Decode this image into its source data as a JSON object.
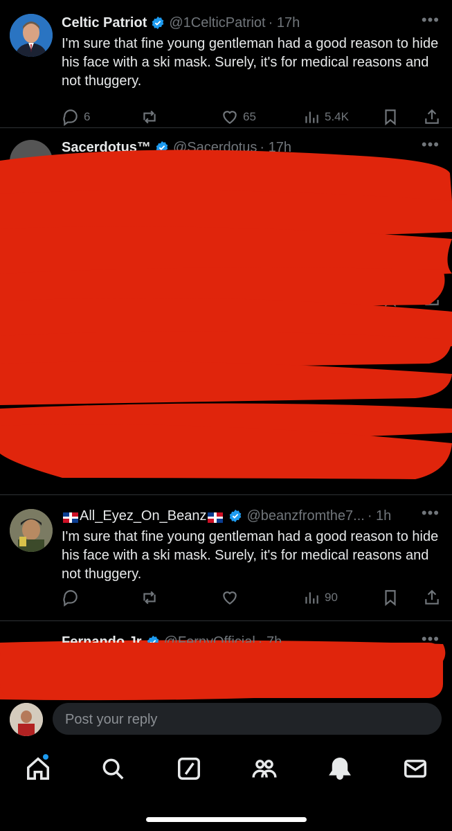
{
  "colors": {
    "background": "#000000",
    "text": "#e7e9ea",
    "muted": "#71767b",
    "verified": "#1d9bf0",
    "redaction": "#e0250c",
    "divider": "#2f3336"
  },
  "tweets": [
    {
      "name": "Celtic Patriot",
      "handle": "@1CelticPatriot",
      "time": "· 17h",
      "more": "•••",
      "text": "I'm sure that fine young gentleman had a good reason to hide his face with a ski mask. Surely, it's for medical reasons and not thuggery.",
      "replies": "6",
      "reposts": "",
      "likes": "65",
      "views": "5.4K"
    },
    {
      "name": "Sacerdotus™",
      "handle": "@Sacerdotus",
      "time": "· 17h",
      "more": "•••"
    },
    {
      "name": "All_Eyez_On_Beanz",
      "handle": "@beanzfromthe7...",
      "time": "· 1h",
      "more": "•••",
      "text": "I'm sure that fine young gentleman had a good reason to hide his face with a ski mask. Surely, it's for medical reasons and not thuggery.",
      "replies": "",
      "reposts": "",
      "likes": "",
      "views": "90"
    },
    {
      "name": "Fernando Jr",
      "handle": "@FernyOfficial",
      "time": "· 7h",
      "more": "•••"
    }
  ],
  "partial": {
    "views": "675",
    "more": "•••"
  },
  "reply": {
    "placeholder": "Post your reply"
  },
  "nav": [
    "home-icon",
    "search-icon",
    "compose-icon",
    "communities-icon",
    "notifications-icon",
    "messages-icon"
  ]
}
